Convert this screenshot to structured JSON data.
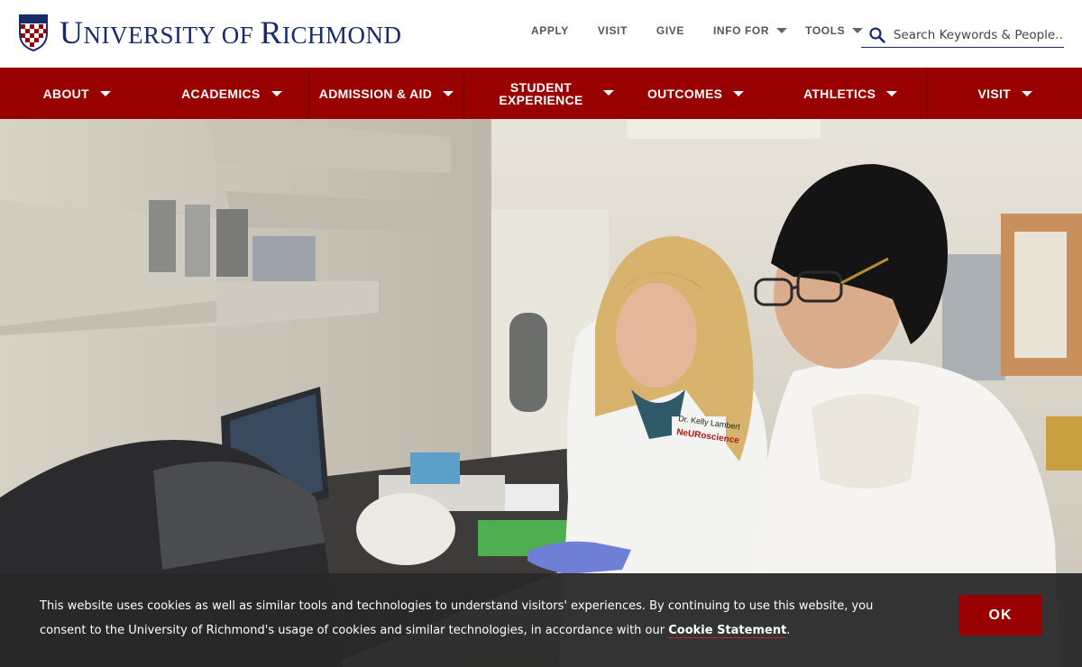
{
  "header": {
    "logo_first": "U",
    "logo_rest1": "NIVERSITY OF ",
    "logo_second": "R",
    "logo_rest2": "ICHMOND"
  },
  "utility": {
    "apply": "APPLY",
    "visit": "VISIT",
    "give": "GIVE",
    "info_for": "INFO FOR",
    "tools": "TOOLS"
  },
  "search": {
    "placeholder": "Search Keywords & People..."
  },
  "nav": {
    "items": [
      {
        "label": "ABOUT"
      },
      {
        "label": "ACADEMICS"
      },
      {
        "label": "ADMISSION & AID"
      },
      {
        "label_line1": "STUDENT",
        "label_line2": "EXPERIENCE"
      },
      {
        "label": "OUTCOMES"
      },
      {
        "label": "ATHLETICS"
      },
      {
        "label": "VISIT"
      }
    ]
  },
  "hero": {
    "coat_name": "Dr. Kelly Lambert",
    "coat_dept": "NeURoscience"
  },
  "cookie": {
    "text_before": "This website uses cookies as well as similar tools and technologies to understand visitors' experiences. By continuing to use this website, you consent to the University of Richmond's usage of cookies and similar technologies, in accordance with our ",
    "link": "Cookie Statement",
    "text_after": ".",
    "ok": "OK"
  },
  "colors": {
    "brand_red": "#990000",
    "brand_navy": "#1a2b6b"
  }
}
